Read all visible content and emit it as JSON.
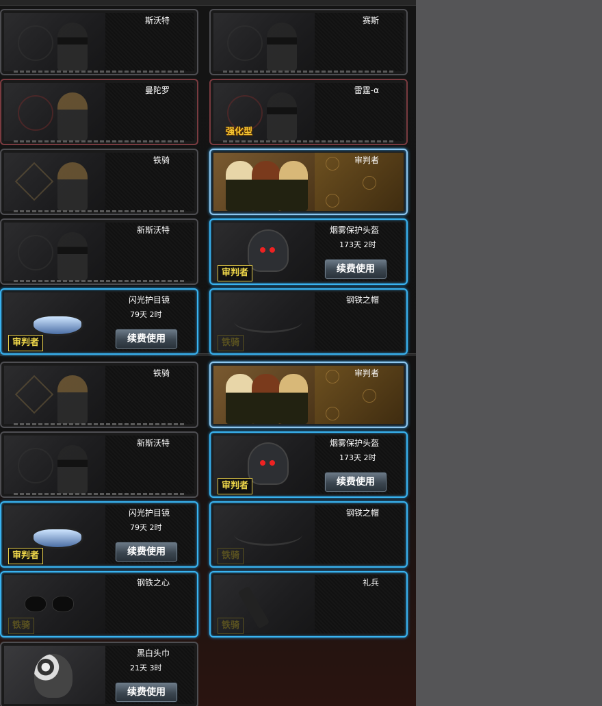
{
  "items": [
    {
      "name": "斯沃特"
    },
    {
      "name": "赛斯"
    },
    {
      "name": "曼陀罗"
    },
    {
      "name": "雷霆-α",
      "badge": "强化型"
    },
    {
      "name": "铁骑"
    },
    {
      "name": "审判者"
    },
    {
      "name": "新斯沃特"
    },
    {
      "name": "烟雾保护头盔",
      "duration": "173天 2时",
      "button": "续费使用",
      "tag": "审判者"
    },
    {
      "name": "闪光护目镜",
      "duration": "79天 2时",
      "button": "续费使用",
      "tag": "审判者"
    },
    {
      "name": "钢铁之帽",
      "tag": "铁骑"
    },
    {
      "name": "铁骑"
    },
    {
      "name": "审判者"
    },
    {
      "name": "新斯沃特"
    },
    {
      "name": "烟雾保护头盔",
      "duration": "173天 2时",
      "button": "续费使用",
      "tag": "审判者"
    },
    {
      "name": "闪光护目镜",
      "duration": "79天 2时",
      "button": "续费使用",
      "tag": "审判者"
    },
    {
      "name": "钢铁之帽",
      "tag": "铁骑"
    },
    {
      "name": "钢铁之心",
      "tag": "铁骑"
    },
    {
      "name": "礼兵",
      "tag": "铁骑"
    },
    {
      "name": "黑白头巾",
      "duration": "21天 3时",
      "button": "续费使用"
    }
  ],
  "colors": {
    "highlight": "#39b3f0",
    "tag": "#f0d84a",
    "background": "#555557"
  }
}
